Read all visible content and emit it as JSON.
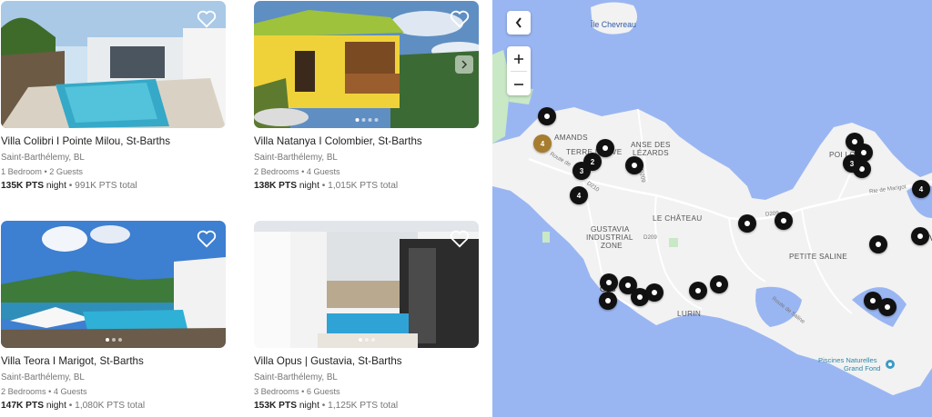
{
  "listings": [
    {
      "title": "Villa Colibri I Pointe Milou, St-Barths",
      "location": "Saint-Barthélemy, BL",
      "meta": "1 Bedroom • 2 Guests",
      "price": "135K PTS",
      "price_unit": " night",
      "total": " • 991K PTS total"
    },
    {
      "title": "Villa Natanya I Colombier, St-Barths",
      "location": "Saint-Barthélemy, BL",
      "meta": "2 Bedrooms • 4 Guests",
      "price": "138K PTS",
      "price_unit": " night",
      "total": " • 1,015K PTS total"
    },
    {
      "title": "Villa Teora I Marigot, St-Barths",
      "location": "Saint-Barthélemy, BL",
      "meta": "2 Bedrooms • 4 Guests",
      "price": "147K PTS",
      "price_unit": " night",
      "total": " • 1,080K PTS total"
    },
    {
      "title": "Villa Opus | Gustavia, St-Barths",
      "location": "Saint-Barthélemy, BL",
      "meta": "3 Bedrooms • 6 Guests",
      "price": "153K PTS",
      "price_unit": " night",
      "total": " • 1,125K PTS total"
    }
  ],
  "map": {
    "zoom_in_label": "+",
    "zoom_out_label": "−",
    "places": {
      "ile_chevreau": "Île Chevreau",
      "flamands": "AMANDS",
      "terre_neuve": "TERRE NEUVE",
      "anse_des_lezards_1": "ANSE DES",
      "anse_des_lezards_2": "LÉZARDS",
      "le_chateau": "LE CHÂTEAU",
      "gustavia_zone_1": "GUSTAVIA",
      "gustavia_zone_2": "INDUSTRIAL",
      "gustavia_zone_3": "ZONE",
      "petite_saline": "PETITE SALINE",
      "lurin": "LURIN",
      "pointe_milou": "POI      LOU",
      "gustavia_town": "Gus",
      "vitet": "V",
      "piscines_1": "Piscines Naturelles",
      "piscines_2": "Grand Fond"
    },
    "roads": {
      "route_de": "Route de",
      "d210": "D210",
      "d209": "D209",
      "d209b": "D209",
      "rte_marigot": "Rte de Marigot",
      "route_saline": "Route de Saline",
      "route_de_2": "Route de"
    },
    "cluster_counts": {
      "gold": "4",
      "c2": "2",
      "c3a": "3",
      "c4a": "4",
      "c3b": "3",
      "c4b": "4"
    }
  },
  "colors": {
    "water": "#9ab6f2",
    "land": "#f2f2f2",
    "park": "#c9e8c6",
    "marker": "#111111",
    "marker_highlight": "#a67c2e"
  }
}
